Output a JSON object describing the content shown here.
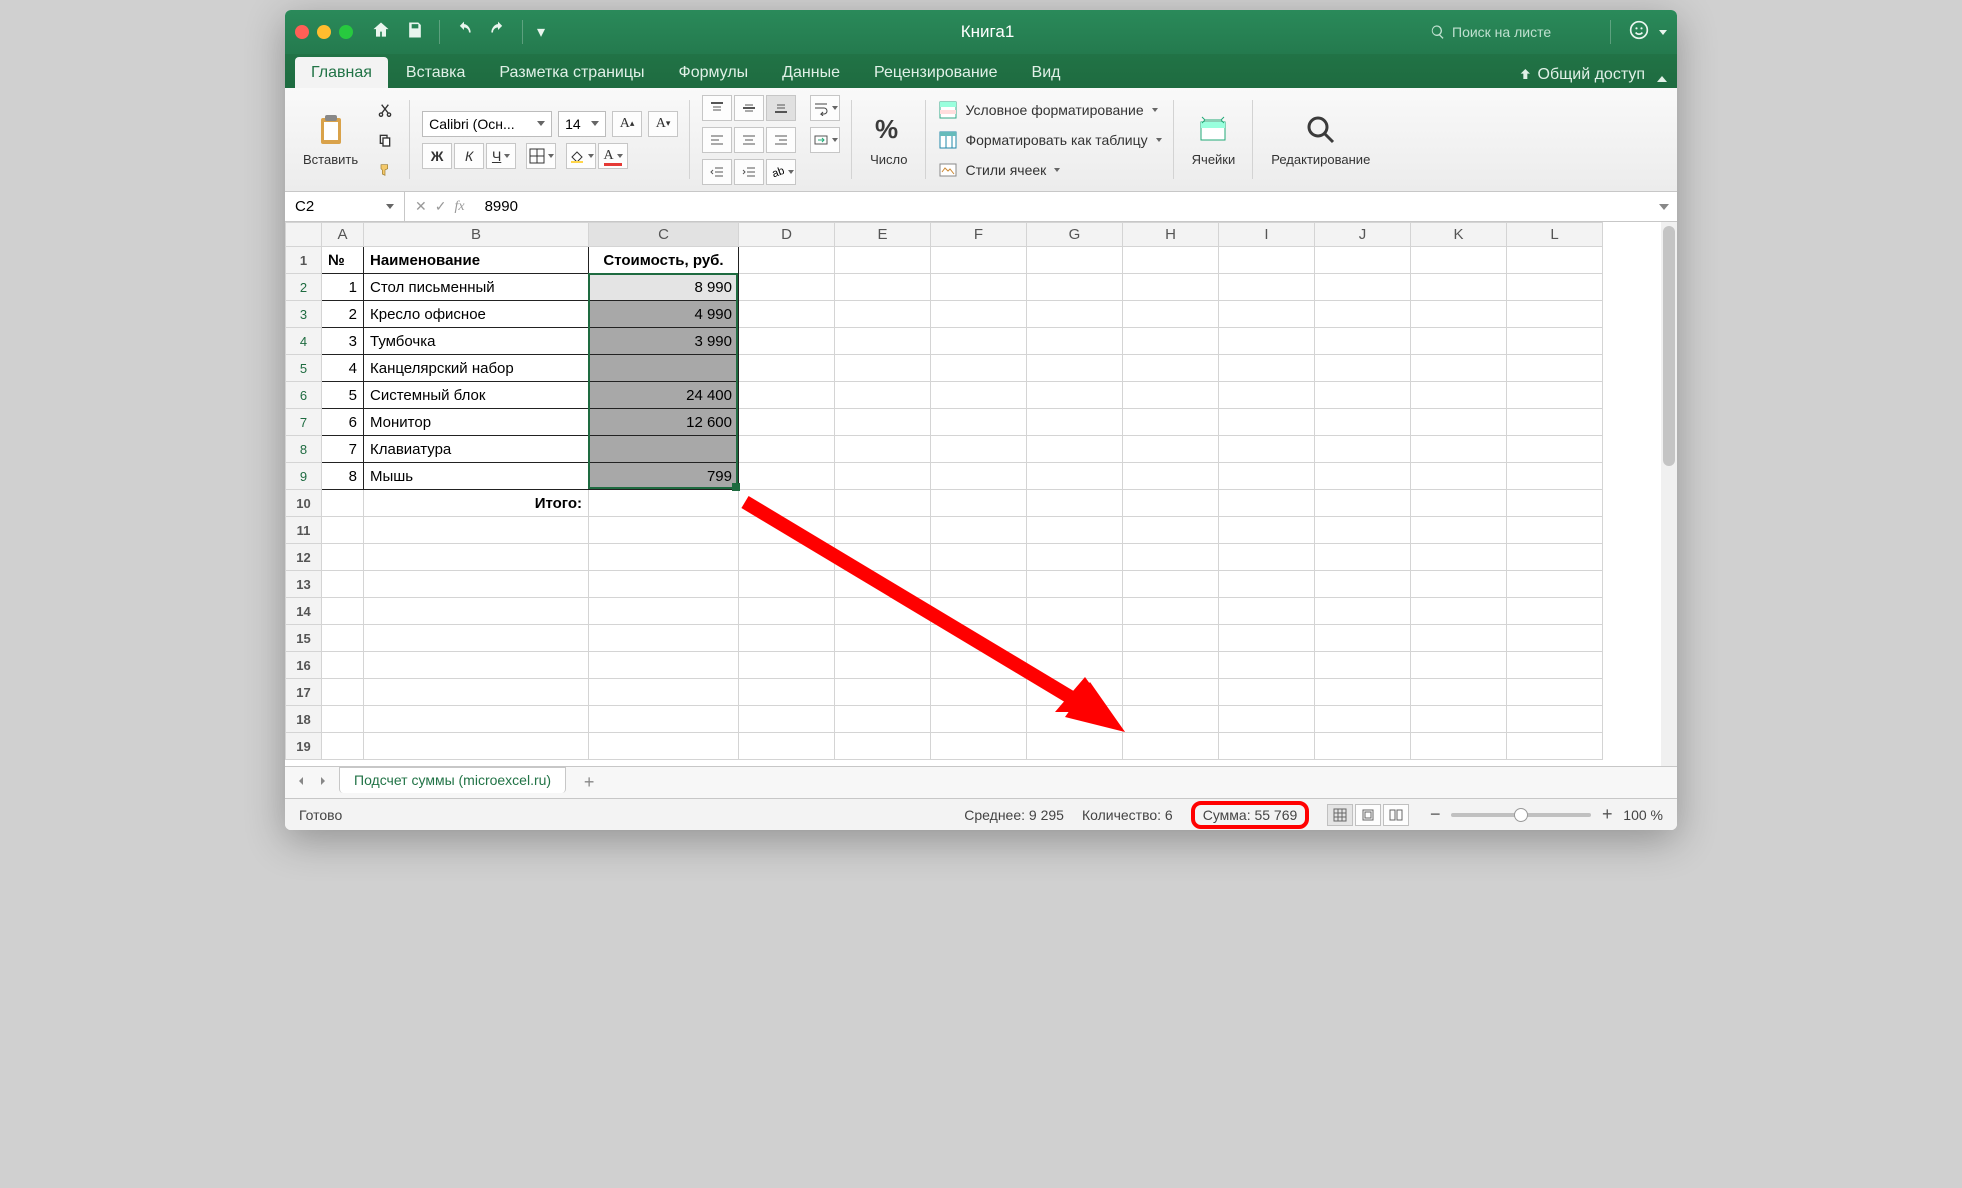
{
  "titlebar": {
    "doc_title": "Книга1",
    "search_placeholder": "Поиск на листе"
  },
  "ribbon": {
    "tabs": [
      "Главная",
      "Вставка",
      "Разметка страницы",
      "Формулы",
      "Данные",
      "Рецензирование",
      "Вид"
    ],
    "share": "Общий доступ",
    "paste_label": "Вставить",
    "font_name": "Calibri (Осн...",
    "font_size": "14",
    "number_label": "Число",
    "styles": {
      "cond": "Условное форматирование",
      "table": "Форматировать как таблицу",
      "cell": "Стили ячеек"
    },
    "cells_label": "Ячейки",
    "editing_label": "Редактирование"
  },
  "formula": {
    "namebox": "C2",
    "value": "8990"
  },
  "columns": [
    "A",
    "B",
    "C",
    "D",
    "E",
    "F",
    "G",
    "H",
    "I",
    "J",
    "K",
    "L"
  ],
  "data": {
    "headers": {
      "a": "№",
      "b": "Наименование",
      "c": "Стоимость, руб."
    },
    "rows": [
      {
        "n": "1",
        "name": "Стол письменный",
        "cost": "8 990"
      },
      {
        "n": "2",
        "name": "Кресло офисное",
        "cost": "4 990"
      },
      {
        "n": "3",
        "name": "Тумбочка",
        "cost": "3 990"
      },
      {
        "n": "4",
        "name": "Канцелярский набор",
        "cost": ""
      },
      {
        "n": "5",
        "name": "Системный блок",
        "cost": "24 400"
      },
      {
        "n": "6",
        "name": "Монитор",
        "cost": "12 600"
      },
      {
        "n": "7",
        "name": "Клавиатура",
        "cost": ""
      },
      {
        "n": "8",
        "name": "Мышь",
        "cost": "799"
      }
    ],
    "total_label": "Итого:"
  },
  "sheet": {
    "name": "Подсчет суммы (microexcel.ru)"
  },
  "status": {
    "ready": "Готово",
    "avg": "Среднее: 9 295",
    "count": "Количество: 6",
    "sum": "Сумма: 55 769",
    "zoom": "100 %"
  }
}
